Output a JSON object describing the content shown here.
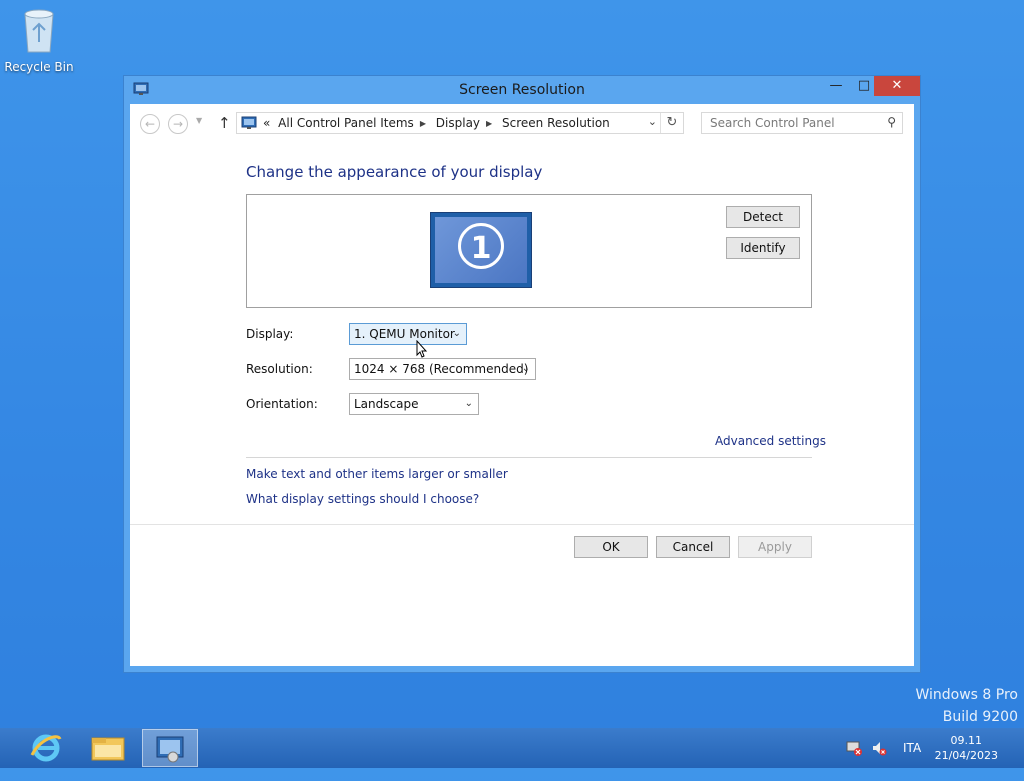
{
  "desktop": {
    "recycle_bin_label": "Recycle Bin",
    "watermark_line1": "Windows 8 Pro",
    "watermark_line2": "Build 9200"
  },
  "window": {
    "title": "Screen Resolution",
    "min_icon": "minimize-icon",
    "max_icon": "maximize-icon",
    "close_icon": "close-icon"
  },
  "navbar": {
    "breadcrumb_lead": "«",
    "breadcrumbs": [
      "All Control Panel Items",
      "Display",
      "Screen Resolution"
    ],
    "search_placeholder": "Search Control Panel"
  },
  "main": {
    "heading": "Change the appearance of your display",
    "monitor_number": "1",
    "detect_label": "Detect",
    "identify_label": "Identify",
    "display_label": "Display:",
    "display_value": "1. QEMU Monitor",
    "resolution_label": "Resolution:",
    "resolution_value": "1024 × 768 (Recommended)",
    "orientation_label": "Orientation:",
    "orientation_value": "Landscape",
    "advanced_settings": "Advanced settings",
    "link_text_size": "Make text and other items larger or smaller",
    "link_which_settings": "What display settings should I choose?"
  },
  "footer": {
    "ok_label": "OK",
    "cancel_label": "Cancel",
    "apply_label": "Apply"
  },
  "taskbar": {
    "language": "ITA",
    "time": "09.11",
    "date": "21/04/2023"
  }
}
